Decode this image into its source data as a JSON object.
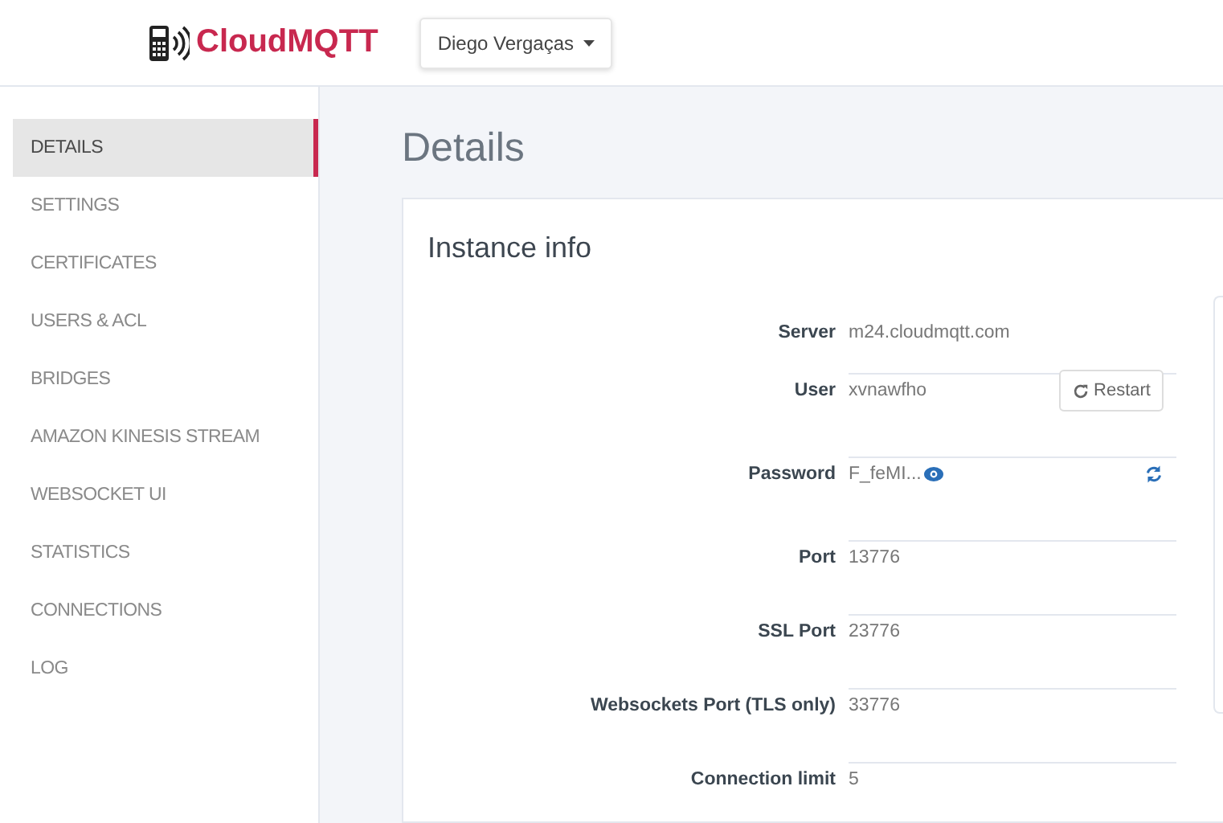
{
  "header": {
    "brand": "CloudMQTT",
    "account": "Diego Vergaças"
  },
  "sidebar": {
    "items": [
      {
        "label": "DETAILS",
        "selected": true
      },
      {
        "label": "SETTINGS",
        "selected": false
      },
      {
        "label": "CERTIFICATES",
        "selected": false
      },
      {
        "label": "USERS & ACL",
        "selected": false
      },
      {
        "label": "BRIDGES",
        "selected": false
      },
      {
        "label": "AMAZON KINESIS STREAM",
        "selected": false
      },
      {
        "label": "WEBSOCKET UI",
        "selected": false
      },
      {
        "label": "STATISTICS",
        "selected": false
      },
      {
        "label": "CONNECTIONS",
        "selected": false
      },
      {
        "label": "LOG",
        "selected": false
      }
    ]
  },
  "page_title": "Details",
  "card": {
    "title": "Instance info",
    "rows": [
      {
        "kind": "text",
        "label": "Server",
        "value": "m24.cloudmqtt.com"
      },
      {
        "kind": "button",
        "label": "User",
        "value": "xvnawfho",
        "button": "Restart"
      },
      {
        "kind": "secret",
        "label": "Password",
        "value": "F_feMI..."
      },
      {
        "kind": "text",
        "label": "Port",
        "value": "13776"
      },
      {
        "kind": "text",
        "label": "SSL Port",
        "value": "23776"
      },
      {
        "kind": "text",
        "label": "Websockets Port (TLS only)",
        "value": "33776"
      },
      {
        "kind": "text",
        "label": "Connection limit",
        "value": "5"
      }
    ]
  }
}
